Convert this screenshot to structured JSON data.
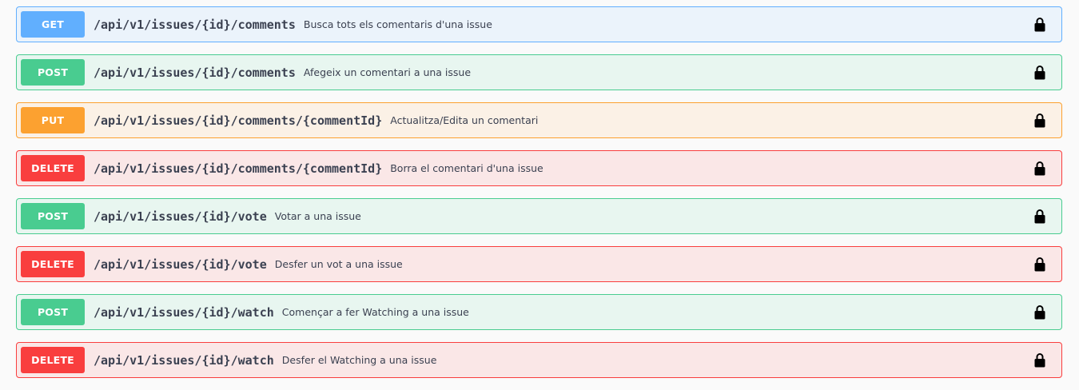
{
  "operations": [
    {
      "method": "GET",
      "path": "/api/v1/issues/{id}/comments",
      "description": "Busca tots els comentaris d'una issue",
      "locked": true
    },
    {
      "method": "POST",
      "path": "/api/v1/issues/{id}/comments",
      "description": "Afegeix un comentari a una issue",
      "locked": true
    },
    {
      "method": "PUT",
      "path": "/api/v1/issues/{id}/comments/{commentId}",
      "description": "Actualitza/Edita un comentari",
      "locked": true
    },
    {
      "method": "DELETE",
      "path": "/api/v1/issues/{id}/comments/{commentId}",
      "description": "Borra el comentari d'una issue",
      "locked": true
    },
    {
      "method": "POST",
      "path": "/api/v1/issues/{id}/vote",
      "description": "Votar a una issue",
      "locked": true
    },
    {
      "method": "DELETE",
      "path": "/api/v1/issues/{id}/vote",
      "description": "Desfer un vot a una issue",
      "locked": true
    },
    {
      "method": "POST",
      "path": "/api/v1/issues/{id}/watch",
      "description": "Començar a fer Watching a una issue",
      "locked": true
    },
    {
      "method": "DELETE",
      "path": "/api/v1/issues/{id}/watch",
      "description": "Desfer el Watching a una issue",
      "locked": true
    }
  ],
  "icons": {
    "lock": "lock-icon"
  },
  "colors": {
    "get": "#61affe",
    "post": "#49cc90",
    "put": "#fca130",
    "delete": "#f93e3e",
    "text": "#3b4151"
  }
}
